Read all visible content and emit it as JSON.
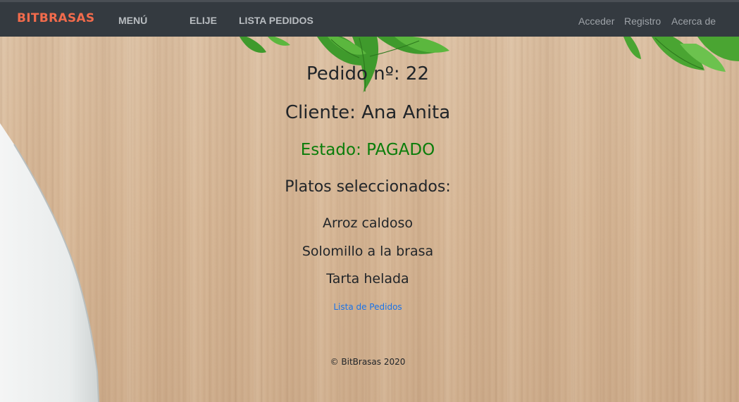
{
  "navbar": {
    "brand": "BITBRASAS",
    "links": {
      "menu": "MENÚ",
      "elije": "ELIJE",
      "lista_pedidos": "LISTA PEDIDOS"
    },
    "right": {
      "acceder": "Acceder",
      "registro": "Registro",
      "acerca": "Acerca de"
    }
  },
  "order": {
    "title": "Pedido nº: 22",
    "client": "Cliente: Ana Anita",
    "status": "Estado: PAGADO",
    "dishes_heading": "Platos seleccionados:",
    "dishes": [
      "Arroz caldoso",
      "Solomillo a la brasa",
      "Tarta helada"
    ],
    "back_link": "Lista de Pedidos"
  },
  "footer": {
    "copyright": "© BitBrasas 2020"
  },
  "colors": {
    "navbar_bg": "#343a40",
    "brand": "#f26b4c",
    "status_paid": "#0a7d0a",
    "link": "#1a73e8"
  }
}
